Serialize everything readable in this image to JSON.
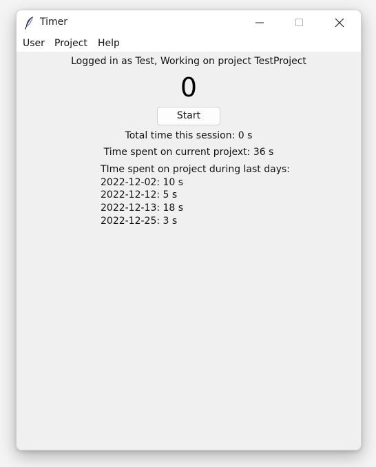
{
  "window": {
    "title": "Timer",
    "icon": "feather-icon",
    "controls": [
      "minimize-icon",
      "maximize-icon",
      "close-icon"
    ]
  },
  "menu": {
    "items": [
      {
        "label": "User"
      },
      {
        "label": "Project"
      },
      {
        "label": "Help"
      }
    ]
  },
  "main": {
    "status": "Logged in as Test, Working on project TestProject",
    "counter": "0",
    "start_label": "Start",
    "total_session": "Total time this session: 0 s",
    "current_project": "Time spent on current projext: 36 s",
    "history_title": "TIme spent on project during last days:",
    "history": [
      "2022-12-02: 10 s",
      "2022-12-12: 5 s",
      "2022-12-13: 18 s",
      "2022-12-25: 3 s"
    ]
  },
  "colors": {
    "titlebar": "#ffffff",
    "window_bg": "#f0f0f0",
    "text": "#111111"
  }
}
